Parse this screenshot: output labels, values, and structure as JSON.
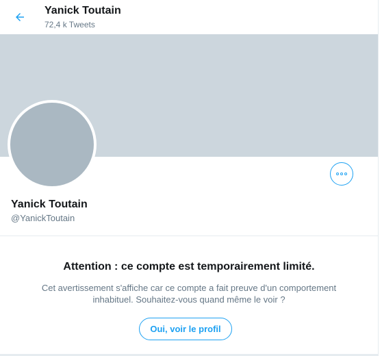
{
  "header": {
    "title": "Yanick Toutain",
    "tweet_count": "72,4 k Tweets",
    "back_icon": "arrow-left-icon"
  },
  "profile": {
    "display_name": "Yanick Toutain",
    "handle": "@YanickToutain",
    "more_icon": "more-options-icon"
  },
  "warning": {
    "title": "Attention : ce compte est temporairement limité.",
    "text": "Cet avertissement s'affiche car ce compte a fait preuve d'un comportement inhabituel. Souhaitez-vous quand même le voir ?",
    "button_label": "Oui, voir le profil"
  },
  "colors": {
    "accent": "#1da1f2",
    "banner": "#ccd6dd",
    "avatar_placeholder": "#aab8c2",
    "secondary_text": "#657786",
    "border": "#e6ecf0"
  }
}
